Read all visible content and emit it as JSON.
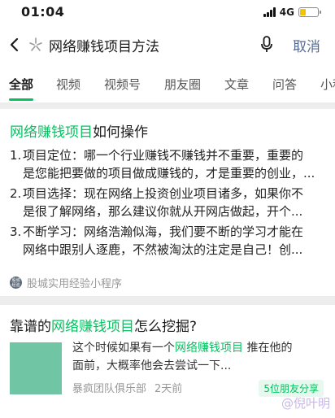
{
  "status": {
    "time": "01:04",
    "network": "4G",
    "battery_level": 0.3
  },
  "search": {
    "query": "网络赚钱项目方法",
    "cancel_label": "取消"
  },
  "tabs": [
    {
      "label": "全部",
      "active": true
    },
    {
      "label": "视频"
    },
    {
      "label": "视频号"
    },
    {
      "label": "朋友圈"
    },
    {
      "label": "文章"
    },
    {
      "label": "问答"
    },
    {
      "label": "小程"
    }
  ],
  "result1": {
    "title_highlight": "网络赚钱项目",
    "title_rest": "如何操作",
    "items": [
      {
        "num": "1.",
        "line1": "项目定位：哪一个行业赚钱不赚钱并不重要，重要的",
        "line2": "是您能把要做的项目做成赚钱的，才是重要的创业，..."
      },
      {
        "num": "2.",
        "line1": "项目选择：现在网络上投资创业项目诸多，如果你不",
        "line2": "是很了解网络，那么建议你就从开网店做起，开个..."
      },
      {
        "num": "3.",
        "line1": "不断学习：网络浩瀚似海，我们要不断的学习才能在",
        "line2": "网络中跟别人逐鹿，不然被淘汰的注定是自己！创..."
      }
    ],
    "source_icon_text": "股城 经验",
    "source": "股城实用经验小程序"
  },
  "result2": {
    "title_pre": "靠谱的",
    "title_highlight": "网络赚钱项目",
    "title_post": "怎么挖掘?",
    "snippet_line1_pre": "这个时候如果有一个",
    "snippet_line1_hl": "网络赚钱项目",
    "snippet_line1_post": " 推在他的",
    "snippet_line2": "面前，大概率他会去尝试一下...",
    "author": "暴疯团队俱乐部",
    "time": "2天前",
    "share_badge": "5位朋友分享",
    "watermark": "@倪叶明"
  },
  "colors": {
    "accent": "#07c160",
    "link": "#576b95",
    "thumb": "#6fc5a4"
  }
}
